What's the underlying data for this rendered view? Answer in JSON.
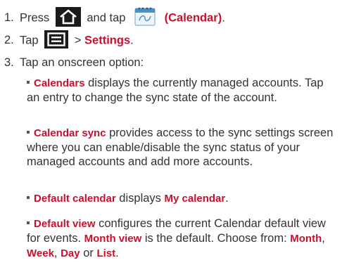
{
  "steps": [
    {
      "num": "1.",
      "text_a": "Press",
      "text_b": "and tap",
      "term": "(Calendar)",
      "end": "."
    },
    {
      "num": "2.",
      "text_a": "Tap",
      "sep": ">",
      "term": "Settings",
      "end": "."
    },
    {
      "num": "3.",
      "text": "Tap an onscreen option:"
    }
  ],
  "bullets": [
    {
      "term": "Calendars",
      "text": " displays the currently managed accounts. Tap an entry to change the sync state of the account."
    },
    {
      "term": "Calendar sync",
      "text": " provides access to the sync settings screen where you can enable/disable the sync status of your managed accounts and add more accounts."
    },
    {
      "term": "Default calendar",
      "text_a": " displays ",
      "term2": "My calendar",
      "end": "."
    },
    {
      "term": "Default view",
      "text_a": " configures the current Calendar default view for events. ",
      "term2": "Month view",
      "text_b": " is the default. Choose from: ",
      "opt1": "Month",
      "c1": ", ",
      "opt2": "Week",
      "c2": ", ",
      "opt3": "Day",
      "c3": " or ",
      "opt4": "List",
      "end": "."
    }
  ],
  "icons": {
    "home": "home-icon",
    "calendar": "calendar-icon",
    "menu": "menu-icon"
  },
  "colors": {
    "term": "#c8102e",
    "text": "#333333",
    "icon_bg": "#1a1a1a"
  }
}
